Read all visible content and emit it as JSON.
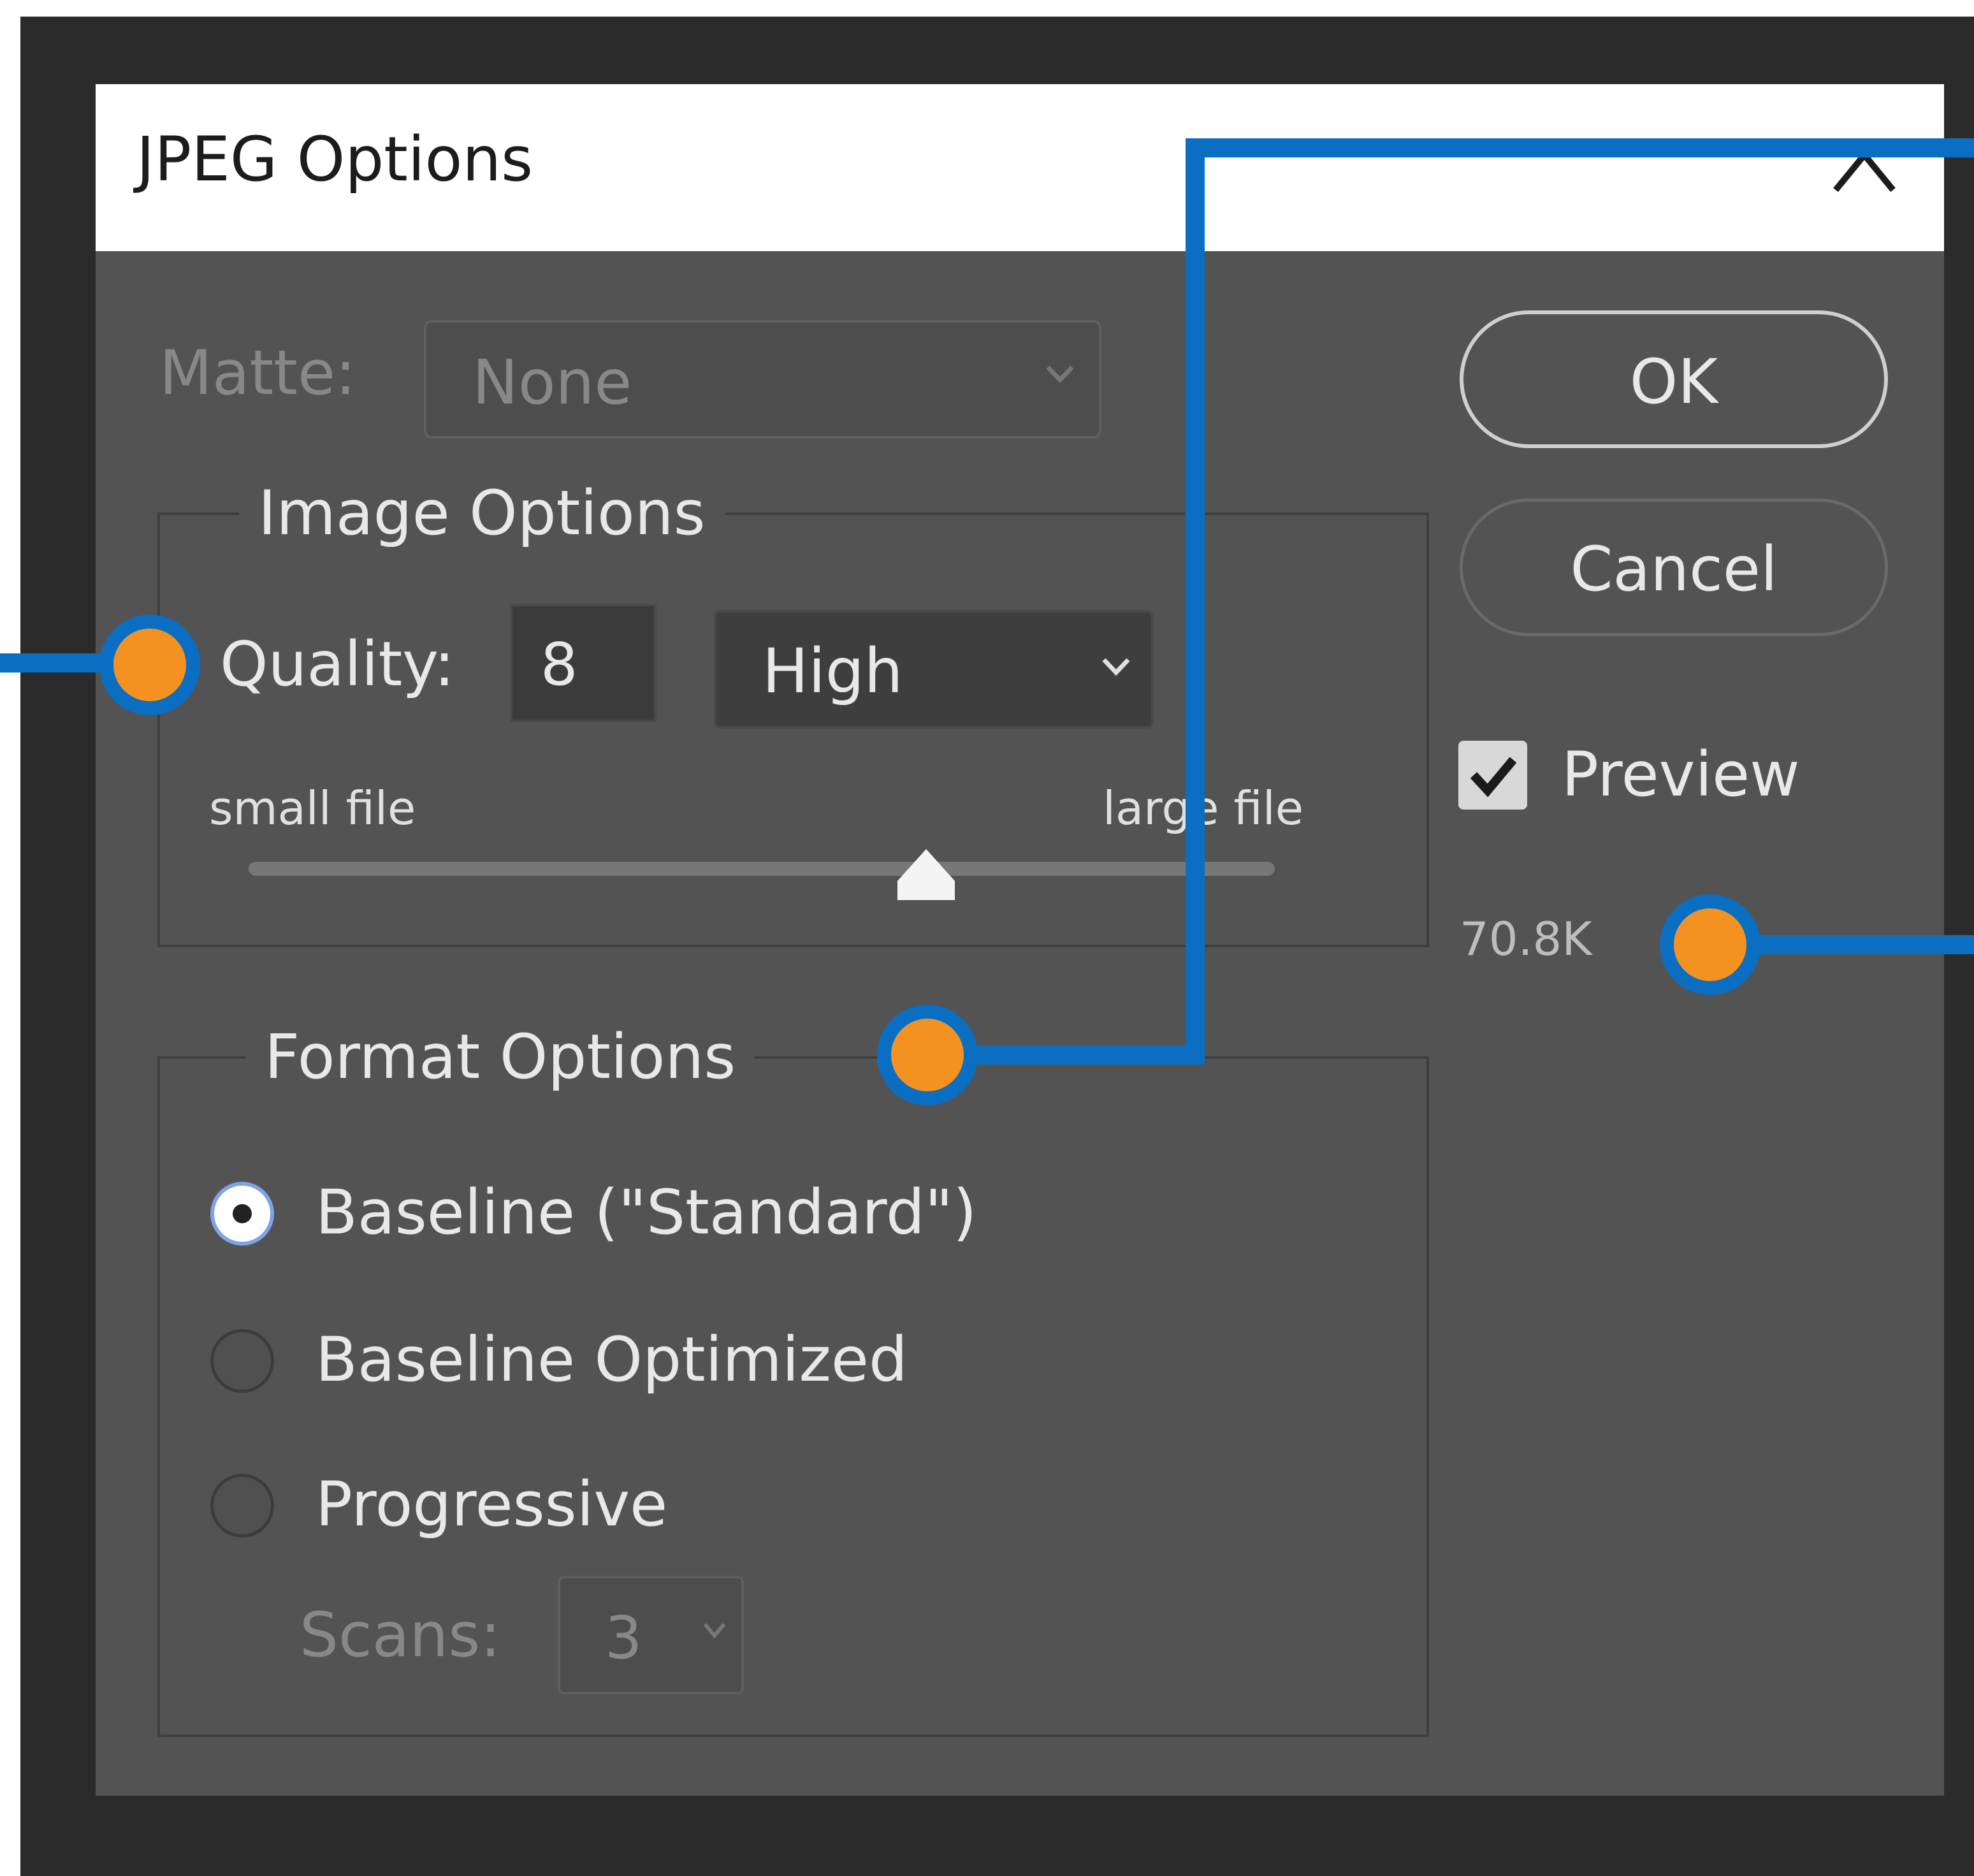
{
  "window": {
    "title": "JPEG Options",
    "close_icon": "close-icon"
  },
  "matte": {
    "label": "Matte:",
    "value": "None"
  },
  "image_options": {
    "legend": "Image Options",
    "quality_label": "Quality:",
    "quality_value": "8",
    "quality_preset": "High",
    "slider_min_label": "small file",
    "slider_max_label": "large file",
    "slider_level": 0.66
  },
  "format_options": {
    "legend": "Format Options",
    "radios": [
      {
        "label": "Baseline (\"Standard\")",
        "selected": true
      },
      {
        "label": "Baseline Optimized",
        "selected": false
      },
      {
        "label": "Progressive",
        "selected": false
      }
    ],
    "scans_label": "Scans:",
    "scans_value": "3"
  },
  "buttons": {
    "ok": "OK",
    "cancel": "Cancel"
  },
  "preview": {
    "label": "Preview",
    "checked": true
  },
  "file_size": "70.8K",
  "colors": {
    "callout_line": "#0a6fc2",
    "callout_dot": "#f39221",
    "dialog_bg": "#535353",
    "frame_bg": "#2b2b2b"
  }
}
